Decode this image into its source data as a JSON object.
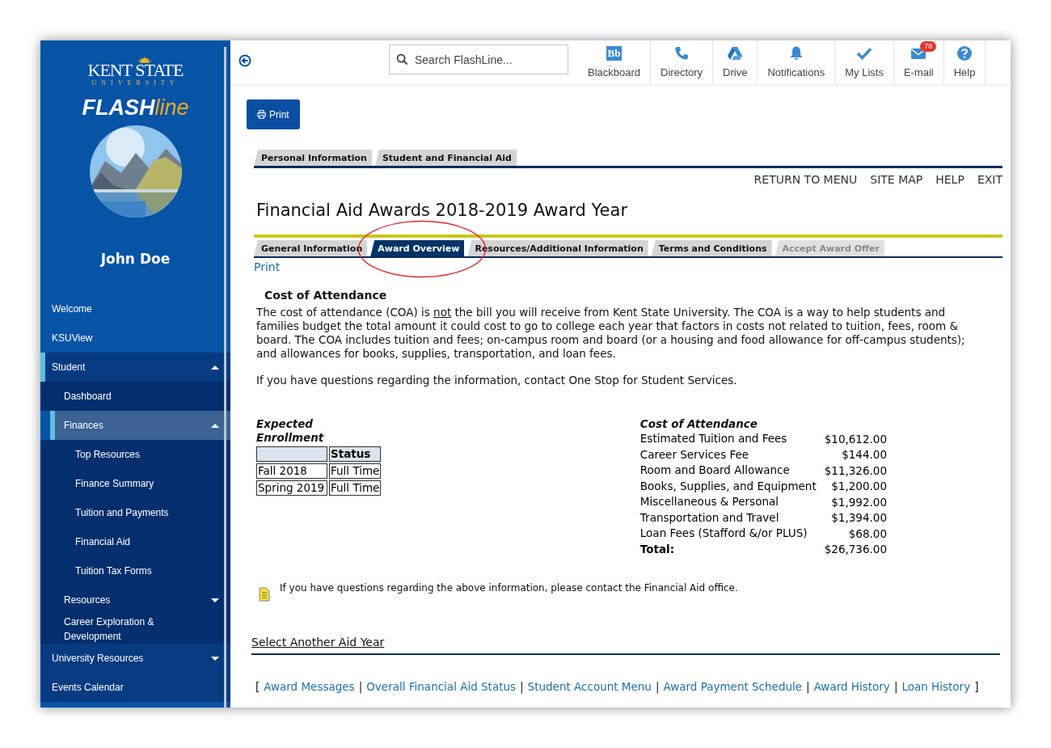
{
  "sidebar": {
    "logo": {
      "name": "KENT STATE",
      "sub": "UNIVERSITY"
    },
    "brand": {
      "bold": "FLASH",
      "light": "line"
    },
    "user_name": "John Doe",
    "items": [
      {
        "label": "Welcome",
        "selected": false
      },
      {
        "label": "KSUView",
        "selected": false
      },
      {
        "label": "Student",
        "selected": true,
        "expanded": true,
        "children": [
          {
            "label": "Dashboard",
            "selected": false
          },
          {
            "label": "Finances",
            "selected": true,
            "expanded": true,
            "children": [
              {
                "label": "Top Resources",
                "selected": false
              },
              {
                "label": "Finance Summary",
                "selected": false
              },
              {
                "label": "Tuition and Payments",
                "selected": false
              },
              {
                "label": "Financial Aid",
                "selected": false
              },
              {
                "label": "Tuition Tax Forms",
                "selected": false
              }
            ]
          },
          {
            "label": "Resources",
            "selected": false,
            "expanded": false
          },
          {
            "label": "Career Exploration & Development",
            "selected": false
          }
        ]
      },
      {
        "label": "University Resources",
        "selected": false,
        "expanded": false
      },
      {
        "label": "Events Calendar",
        "selected": false
      }
    ]
  },
  "header": {
    "search": {
      "placeholder": "Search FlashLine..."
    },
    "nav": [
      {
        "label": "Blackboard",
        "icon_text": "Bb"
      },
      {
        "label": "Directory"
      },
      {
        "label": "Drive"
      },
      {
        "label": "Notifications"
      },
      {
        "label": "My Lists"
      },
      {
        "label": "E-mail",
        "badge": "78"
      },
      {
        "label": "Help"
      }
    ]
  },
  "print_button": "Print",
  "top_tabs": [
    {
      "label": "Personal Information",
      "selected": false
    },
    {
      "label": "Student and Financial Aid",
      "selected": false
    }
  ],
  "menu_links": [
    "RETURN TO MENU",
    "SITE MAP",
    "HELP",
    "EXIT"
  ],
  "title": "Financial Aid Awards 2018-2019 Award Year",
  "tabs": [
    {
      "label": "General Information",
      "selected": false,
      "disabled": false
    },
    {
      "label": "Award Overview",
      "selected": true,
      "disabled": false
    },
    {
      "label": "Resources/Additional Information",
      "selected": false,
      "disabled": false
    },
    {
      "label": "Terms and Conditions",
      "selected": false,
      "disabled": false
    },
    {
      "label": "Accept Award Offer",
      "selected": false,
      "disabled": true
    }
  ],
  "print_link": "Print",
  "section_heading": "Cost of Attendance",
  "paragraph": [
    {
      "text": "The cost of attendance (COA) is ",
      "underline": false
    },
    {
      "text": "not",
      "underline": true
    },
    {
      "text": " the bill you will receive from Kent State University. The COA is a way to help students and families budget the total amount it could cost to go to college each year that factors in costs not related to tuition, fees, room & board. The COA includes tuition and fees; on-campus room and board (or a housing and food allowance for off-campus students); and allowances for books, supplies, transportation, and loan fees.",
      "underline": false
    }
  ],
  "contact_text": "If you have questions regarding the information, contact One Stop for Student Services.",
  "enrollment": {
    "title": "Expected Enrollment",
    "status_header": "Status",
    "rows": [
      {
        "term": "Fall 2018",
        "status": "Full Time"
      },
      {
        "term": "Spring 2019",
        "status": "Full Time"
      }
    ]
  },
  "cost": {
    "title": "Cost of Attendance",
    "rows": [
      {
        "kind": "item",
        "label": "Estimated Tuition and Fees",
        "amount": "$10,612.00"
      },
      {
        "kind": "item",
        "label": "Career Services Fee",
        "amount": "$144.00"
      },
      {
        "kind": "item",
        "label": "Room and Board Allowance",
        "amount": "$11,326.00"
      },
      {
        "kind": "item",
        "label": "Books, Supplies, and Equipment",
        "amount": "$1,200.00"
      },
      {
        "kind": "item",
        "label": "Miscellaneous & Personal",
        "amount": "$1,992.00"
      },
      {
        "kind": "item",
        "label": "Transportation and Travel",
        "amount": "$1,394.00"
      },
      {
        "kind": "item",
        "label": "Loan Fees (Stafford &/or PLUS)",
        "amount": "$68.00"
      },
      {
        "kind": "total",
        "label": "Total:",
        "amount": "$26,736.00"
      }
    ]
  },
  "note": "If you have questions regarding the above information, please contact the Financial Aid office.",
  "select_year_link": "Select Another Aid Year",
  "footer_links": [
    {
      "kind": "bracket",
      "text": "["
    },
    {
      "kind": "link",
      "text": "Award Messages"
    },
    {
      "kind": "separator",
      "text": "|"
    },
    {
      "kind": "link",
      "text": "Overall Financial Aid Status"
    },
    {
      "kind": "separator",
      "text": "|"
    },
    {
      "kind": "link",
      "text": "Student Account Menu"
    },
    {
      "kind": "separator",
      "text": "|"
    },
    {
      "kind": "link",
      "text": "Award Payment Schedule"
    },
    {
      "kind": "separator",
      "text": "|"
    },
    {
      "kind": "link",
      "text": "Award History"
    },
    {
      "kind": "separator",
      "text": "|"
    },
    {
      "kind": "link",
      "text": "Loan History"
    },
    {
      "kind": "bracket",
      "text": "]"
    }
  ]
}
